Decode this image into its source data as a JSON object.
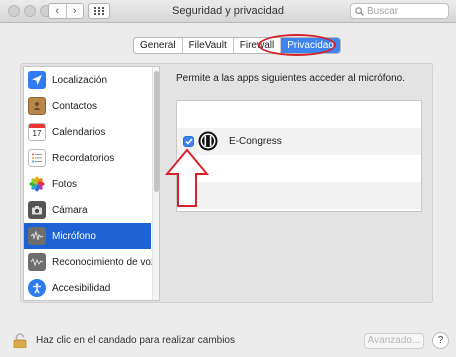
{
  "window": {
    "title": "Seguridad y privacidad",
    "search_placeholder": "Buscar",
    "back_glyph": "‹",
    "forward_glyph": "›"
  },
  "tabs": [
    {
      "label": "General",
      "active": false
    },
    {
      "label": "FileVault",
      "active": false
    },
    {
      "label": "Firewall",
      "active": false
    },
    {
      "label": "Privacidad",
      "active": true
    }
  ],
  "sidebar": {
    "items": [
      {
        "label": "Localización",
        "icon": "location-arrow-icon",
        "selected": false
      },
      {
        "label": "Contactos",
        "icon": "contacts-book-icon",
        "selected": false
      },
      {
        "label": "Calendarios",
        "icon": "calendar-icon",
        "selected": false,
        "icon_text": "17"
      },
      {
        "label": "Recordatorios",
        "icon": "reminders-list-icon",
        "selected": false
      },
      {
        "label": "Fotos",
        "icon": "photos-flower-icon",
        "selected": false
      },
      {
        "label": "Cámara",
        "icon": "camera-icon",
        "selected": false
      },
      {
        "label": "Micrófono",
        "icon": "microphone-waveform-icon",
        "selected": true
      },
      {
        "label": "Reconocimiento de voz",
        "icon": "speech-waveform-icon",
        "selected": false
      },
      {
        "label": "Accesibilidad",
        "icon": "accessibility-icon",
        "selected": false
      }
    ]
  },
  "main": {
    "description": "Permite a las apps siguientes acceder al micrófono.",
    "apps": [
      {
        "name": "E-Congress",
        "checked": true,
        "icon": "e-congress-app-icon"
      }
    ]
  },
  "footer": {
    "lock_message": "Haz clic en el candado para realizar cambios",
    "advanced_label": "Avanzado...",
    "help_label": "?"
  },
  "colors": {
    "selection_blue": "#1e63d6",
    "annotation_red": "#d7222b",
    "checkbox_blue": "#3b83f0"
  }
}
